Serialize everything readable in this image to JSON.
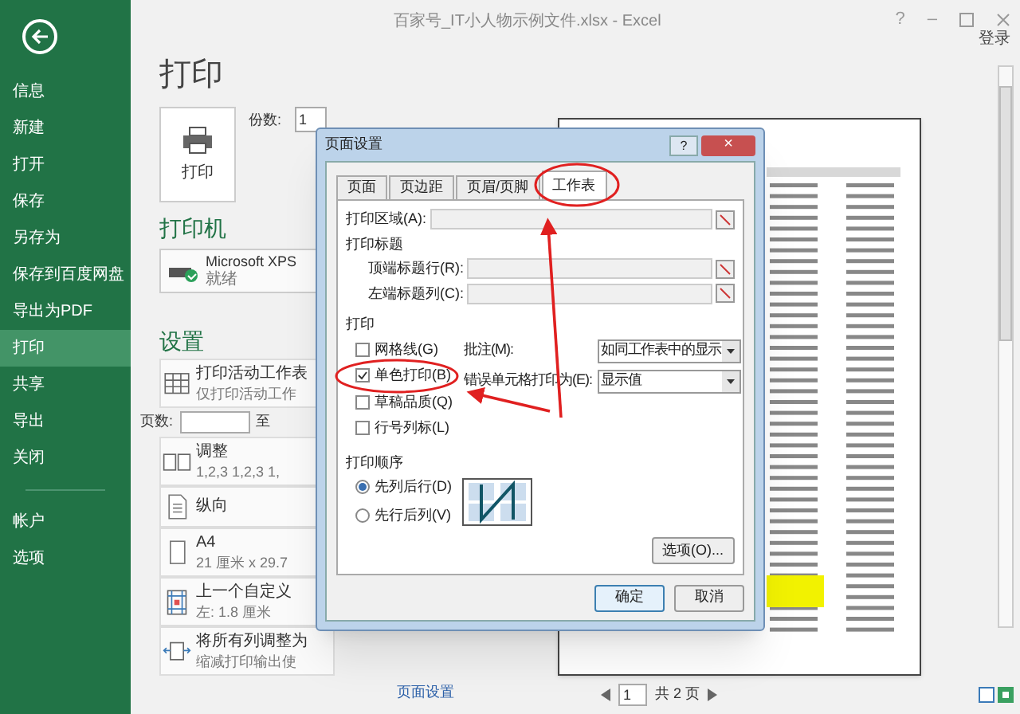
{
  "window": {
    "title": "百家号_IT小人物示例文件.xlsx - Excel",
    "help": "?",
    "minimize": "–",
    "sign_in": "登录"
  },
  "sidebar": {
    "items": [
      {
        "label": "信息",
        "selected": false
      },
      {
        "label": "新建",
        "selected": false
      },
      {
        "label": "打开",
        "selected": false
      },
      {
        "label": "保存",
        "selected": false
      },
      {
        "label": "另存为",
        "selected": false
      },
      {
        "label": "保存到百度网盘",
        "selected": false
      },
      {
        "label": "导出为PDF",
        "selected": false
      },
      {
        "label": "打印",
        "selected": true
      },
      {
        "label": "共享",
        "selected": false
      },
      {
        "label": "导出",
        "selected": false
      },
      {
        "label": "关闭",
        "selected": false
      }
    ],
    "bottom_items": [
      {
        "label": "帐户",
        "selected": false
      },
      {
        "label": "选项",
        "selected": false
      }
    ]
  },
  "print": {
    "title": "打印",
    "print_button": "打印",
    "copies_label": "份数:",
    "copies": "1",
    "printer_heading": "打印机",
    "printer_name": "Microsoft XPS",
    "printer_status": "就绪",
    "settings_heading": "设置",
    "settings": [
      {
        "title": "打印活动工作表",
        "subtitle": "仅打印活动工作"
      },
      {
        "title": "调整",
        "subtitle": "1,2,3   1,2,3   1,"
      },
      {
        "title": "纵向"
      },
      {
        "title": "A4",
        "subtitle": "21 厘米 x 29.7"
      },
      {
        "title": "上一个自定义",
        "subtitle": "左: 1.8 厘米"
      },
      {
        "title": "将所有列调整为",
        "subtitle": "缩减打印输出使"
      }
    ],
    "pages_label": "页数:",
    "pages_to": "至",
    "page_setup_link": "页面设置"
  },
  "preview": {
    "page_current": "1",
    "page_total": "共 2 页"
  },
  "dialog": {
    "title": "页面设置",
    "help": "?",
    "close": "×",
    "tabs": [
      {
        "label": "页面",
        "selected": false
      },
      {
        "label": "页边距",
        "selected": false
      },
      {
        "label": "页眉/页脚",
        "selected": false
      },
      {
        "label": "工作表",
        "selected": true
      }
    ],
    "print_area_label": "打印区域(A):",
    "print_titles_heading": "打印标题",
    "top_rows_label": "顶端标题行(R):",
    "left_cols_label": "左端标题列(C):",
    "print_heading": "打印",
    "checkboxes": [
      {
        "label": "网格线(G)",
        "checked": false
      },
      {
        "label": "单色打印(B)",
        "checked": true
      },
      {
        "label": "草稿品质(Q)",
        "checked": false
      },
      {
        "label": "行号列标(L)",
        "checked": false
      }
    ],
    "comments_label": "批注(M):",
    "comments_value": "如同工作表中的显示",
    "errors_label": "错误单元格打印为(E):",
    "errors_value": "显示值",
    "order_heading": "打印顺序",
    "order": [
      {
        "label": "先列后行(D)",
        "selected": true
      },
      {
        "label": "先行后列(V)",
        "selected": false
      }
    ],
    "options_button": "选项(O)...",
    "ok_button": "确定",
    "cancel_button": "取消"
  }
}
